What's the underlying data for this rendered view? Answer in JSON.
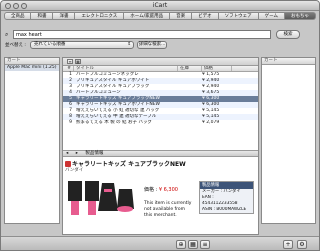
{
  "window": {
    "title": "iCart"
  },
  "tabs": [
    {
      "label": "全商品",
      "active": false
    },
    {
      "label": "和書",
      "active": false
    },
    {
      "label": "洋書",
      "active": false
    },
    {
      "label": "エレクトロニクス",
      "active": false
    },
    {
      "label": "ホーム/家庭用品",
      "active": false
    },
    {
      "label": "音楽",
      "active": false
    },
    {
      "label": "ビデオ",
      "active": false
    },
    {
      "label": "ソフトウェア",
      "active": false
    },
    {
      "label": "ゲーム",
      "active": false
    },
    {
      "label": "おもちゃ",
      "active": true
    }
  ],
  "search": {
    "value": "max heart",
    "button": "検索"
  },
  "filter": {
    "label": "並べ替え :",
    "selected": "売れている順番",
    "detail_button": "詳細な検索..."
  },
  "left_pane": {
    "header": "カート",
    "items": [
      "Apple Mac mini (1.25)"
    ]
  },
  "right_pane": {
    "header": "カート"
  },
  "table": {
    "columns": [
      "#",
      "タイトル",
      "在庫",
      "価格"
    ],
    "rows": [
      {
        "num": "1",
        "title": "ハートフルコミューンネックレ",
        "stock": "",
        "price": "¥ 1,575"
      },
      {
        "num": "2",
        "title": "プリキュアスタイル キュアホワイト",
        "stock": "",
        "price": "¥ 2,940"
      },
      {
        "num": "3",
        "title": "プリキュアスタイル キュアブラック",
        "stock": "",
        "price": "¥ 2,940"
      },
      {
        "num": "4",
        "title": "ハートフルコミューン",
        "stock": "",
        "price": "¥ 3,675"
      },
      {
        "num": "5",
        "title": "キャラリートキッズ キュアブラックNEW",
        "stock": "",
        "price": "¥ 6,300"
      },
      {
        "num": "6",
        "title": "キャラリートキッズ キュアホワイトNEW",
        "stock": "",
        "price": "¥ 6,300"
      },
      {
        "num": "7",
        "title": "増ええらいてえる 小 虹 適切な 連 バッグ",
        "stock": "",
        "price": "¥ 5,145"
      },
      {
        "num": "8",
        "title": "増ええらいてえる 中 連 適切なテーブル",
        "stock": "",
        "price": "¥ 5,145"
      },
      {
        "num": "9",
        "title": "熊まるてえる 木 製 の 結 お子 バッグ",
        "stock": "",
        "price": "¥ 2,079"
      }
    ],
    "selected_index": 4
  },
  "detail_tabs": [
    "◂",
    "▸",
    "製品情報"
  ],
  "detail": {
    "title": "キャラリートキッズ キュアブラックNEW",
    "brand": "バンダイ",
    "price_label": "価格 :",
    "price": "¥ 6,300",
    "stock_message": "This item is currently not available from this merchant.",
    "info_header": "製品情報",
    "info_rows": [
      "メーカー : バンダイ",
      "EAN :",
      "4543112233558",
      "ASIN : B000MAWZLE"
    ]
  },
  "bottom_buttons": {
    "zoom": "⊕",
    "grid": "▦",
    "list": "≡",
    "add": "+",
    "gear": "⚙"
  }
}
